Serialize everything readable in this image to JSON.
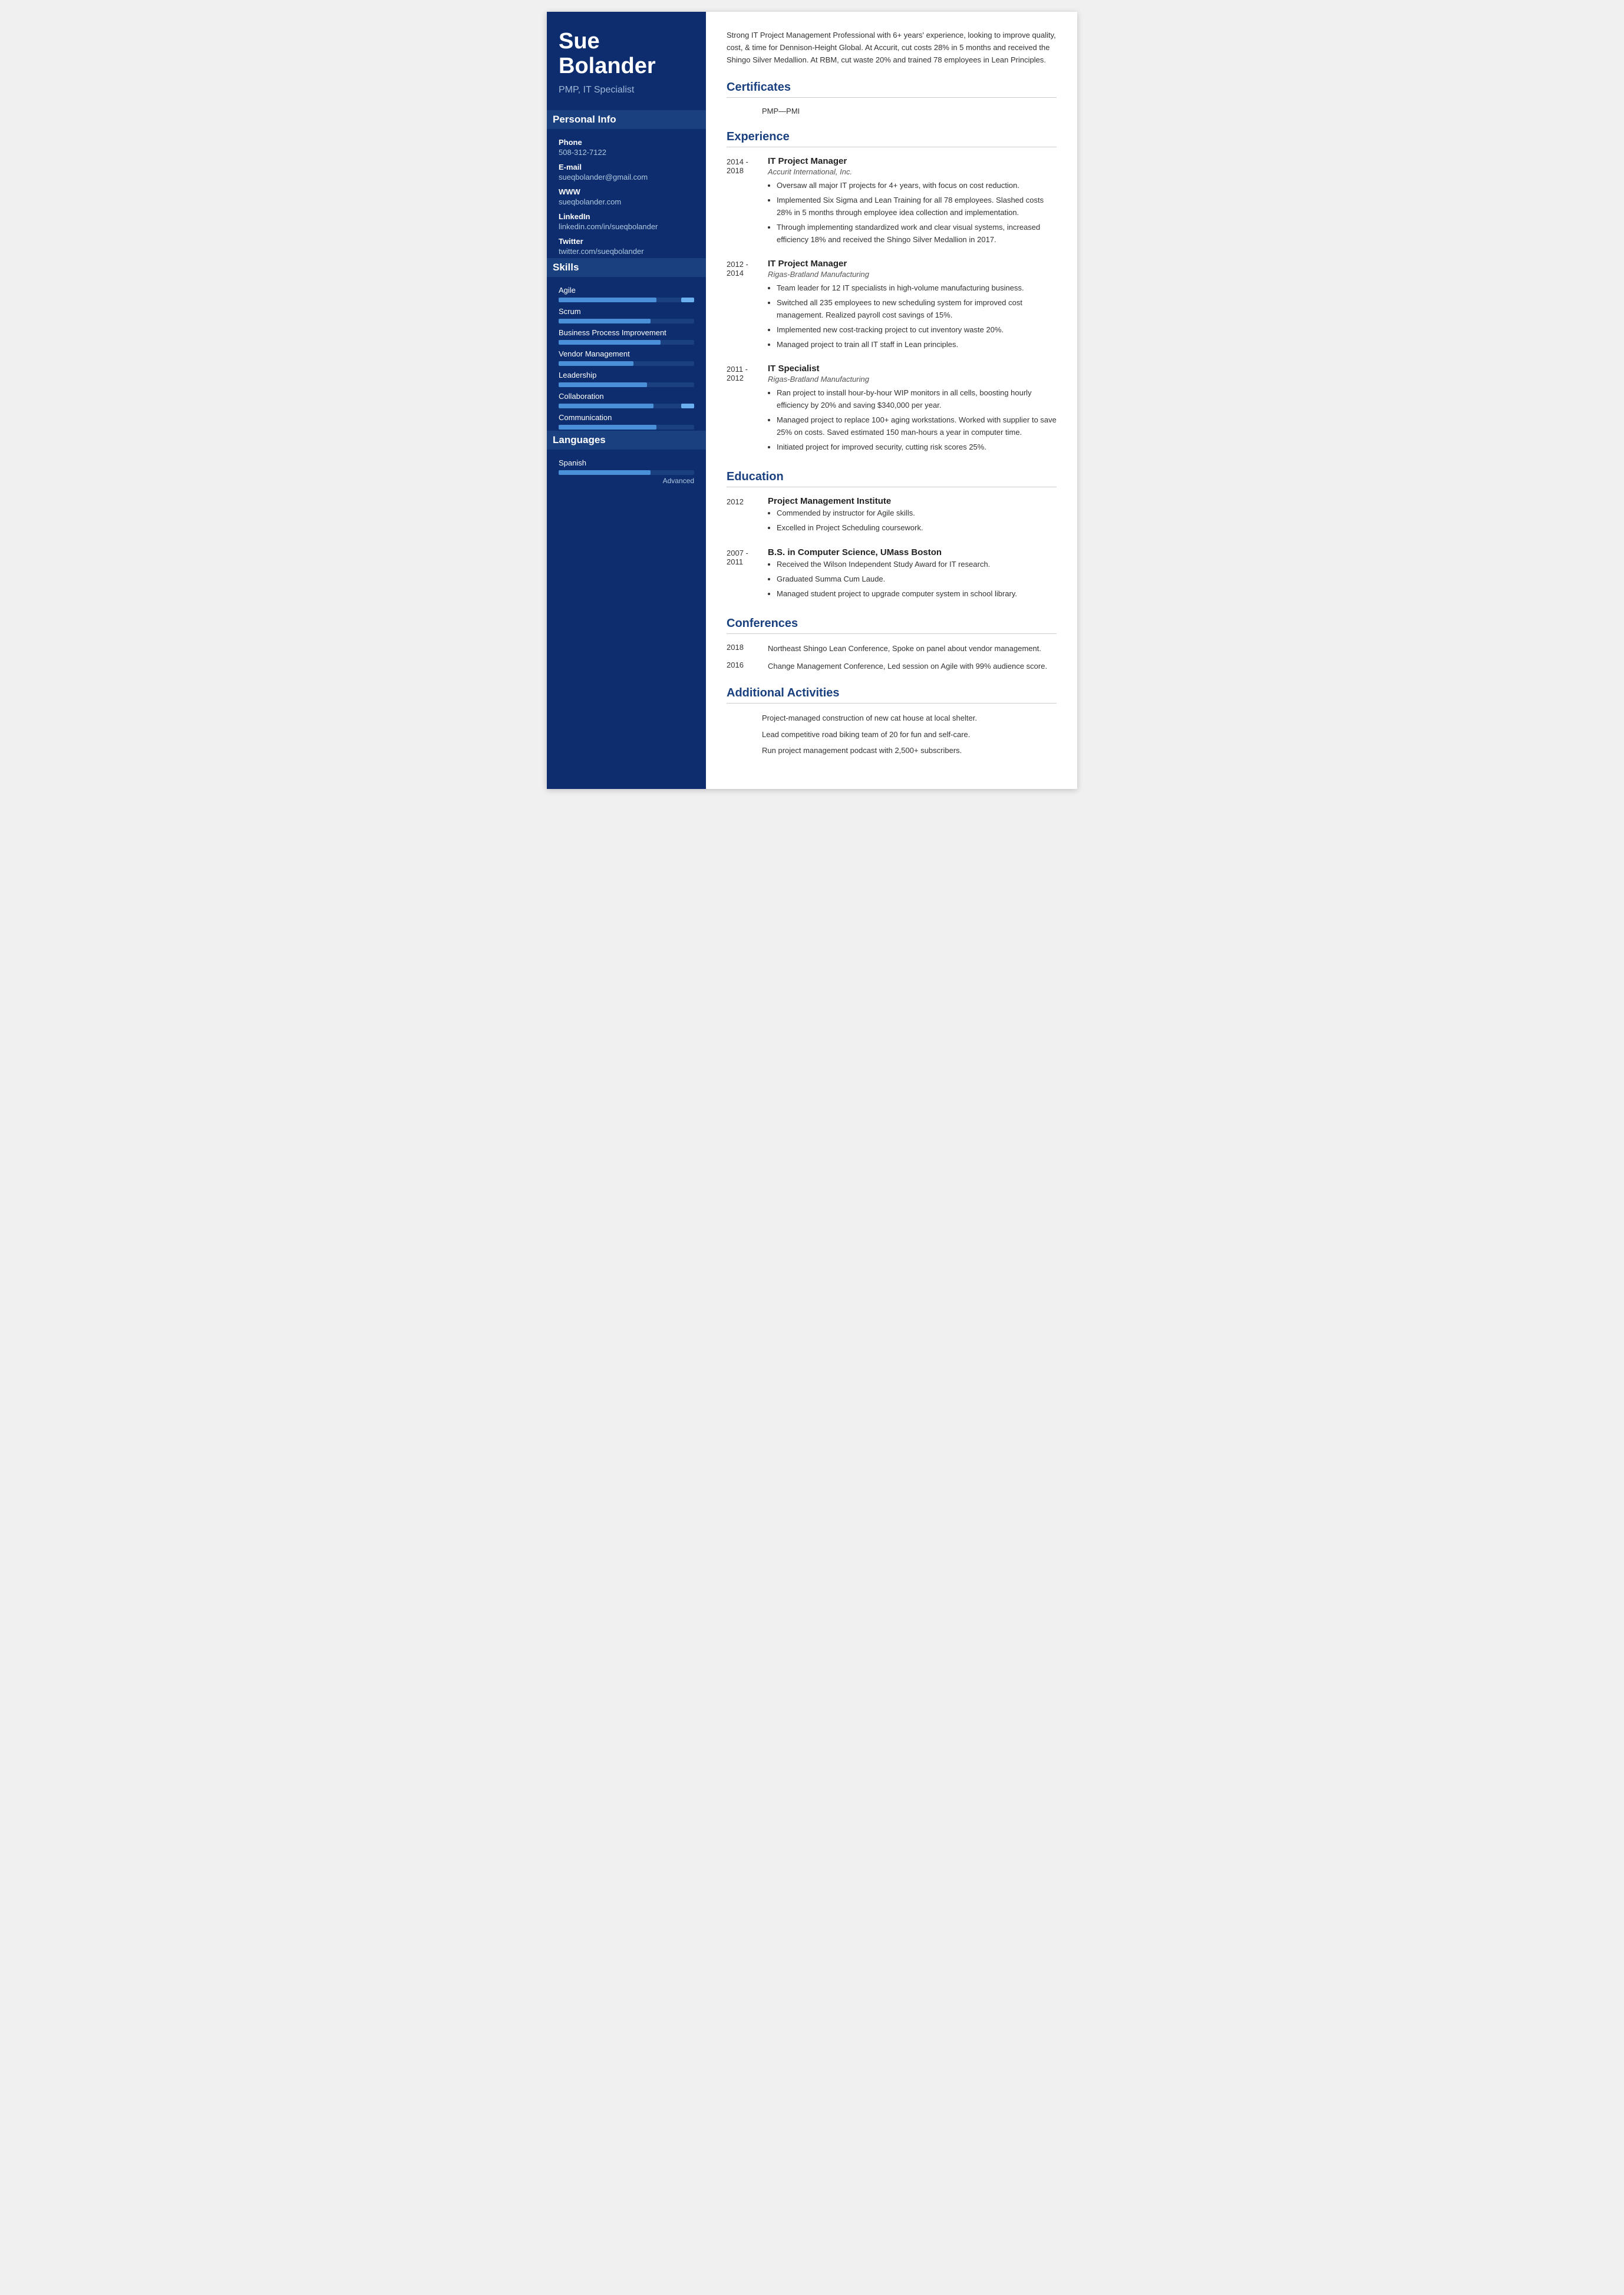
{
  "sidebar": {
    "name": "Sue\nBolander",
    "name_line1": "Sue",
    "name_line2": "Bolander",
    "title": "PMP, IT Specialist",
    "personal_info_label": "Personal Info",
    "phone_label": "Phone",
    "phone_value": "508-312-7122",
    "email_label": "E-mail",
    "email_value": "sueqbolander@gmail.com",
    "www_label": "WWW",
    "www_value": "sueqbolander.com",
    "linkedin_label": "LinkedIn",
    "linkedin_value": "linkedin.com/in/sueqbolander",
    "twitter_label": "Twitter",
    "twitter_value": "twitter.com/sueqbolander",
    "skills_label": "Skills",
    "skills": [
      {
        "name": "Agile",
        "fill_pct": 72,
        "has_accent": true
      },
      {
        "name": "Scrum",
        "fill_pct": 68,
        "has_accent": false
      },
      {
        "name": "Business Process Improvement",
        "fill_pct": 75,
        "has_accent": false
      },
      {
        "name": "Vendor Management",
        "fill_pct": 55,
        "has_accent": false
      },
      {
        "name": "Leadership",
        "fill_pct": 65,
        "has_accent": false
      },
      {
        "name": "Collaboration",
        "fill_pct": 70,
        "has_accent": true
      },
      {
        "name": "Communication",
        "fill_pct": 72,
        "has_accent": false
      }
    ],
    "languages_label": "Languages",
    "languages": [
      {
        "name": "Spanish",
        "fill_pct": 68,
        "level": "Advanced"
      }
    ]
  },
  "main": {
    "summary": "Strong IT Project Management Professional with 6+ years' experience, looking to improve quality, cost, & time for Dennison-Height Global. At Accurit, cut costs 28% in 5 months and received the Shingo Silver Medallion. At RBM, cut waste 20% and trained 78 employees in Lean Principles.",
    "certificates_title": "Certificates",
    "certificates": [
      {
        "text": "PMP—PMI"
      }
    ],
    "experience_title": "Experience",
    "experience": [
      {
        "date": "2014 -\n2018",
        "title": "IT Project Manager",
        "company": "Accurit International, Inc.",
        "bullets": [
          "Oversaw all major IT projects for 4+ years, with focus on cost reduction.",
          "Implemented Six Sigma and Lean Training for all 78 employees. Slashed costs 28% in 5 months through employee idea collection and implementation.",
          "Through implementing standardized work and clear visual systems, increased efficiency 18% and received the Shingo Silver Medallion in 2017."
        ]
      },
      {
        "date": "2012 -\n2014",
        "title": "IT Project Manager",
        "company": "Rigas-Bratland Manufacturing",
        "bullets": [
          "Team leader for 12 IT specialists in high-volume manufacturing business.",
          "Switched all 235 employees to new scheduling system for improved cost management. Realized payroll cost savings of 15%.",
          "Implemented new cost-tracking project to cut inventory waste 20%.",
          "Managed project to train all IT staff in Lean principles."
        ]
      },
      {
        "date": "2011 -\n2012",
        "title": "IT Specialist",
        "company": "Rigas-Bratland Manufacturing",
        "bullets": [
          "Ran project to install hour-by-hour WIP monitors in all cells, boosting hourly efficiency by 20% and saving $340,000 per year.",
          "Managed project to replace 100+ aging workstations. Worked with supplier to save 25% on costs. Saved estimated 150 man-hours a year in computer time.",
          "Initiated project for improved security, cutting risk scores 25%."
        ]
      }
    ],
    "education_title": "Education",
    "education": [
      {
        "date": "2012",
        "title": "Project Management Institute",
        "company": "",
        "bullets": [
          "Commended by instructor for Agile skills.",
          "Excelled in Project Scheduling coursework."
        ]
      },
      {
        "date": "2007 -\n2011",
        "title": "B.S. in Computer Science, UMass Boston",
        "company": "",
        "bullets": [
          "Received the Wilson Independent Study Award for IT research.",
          "Graduated Summa Cum Laude.",
          "Managed student project to upgrade computer system in school library."
        ]
      }
    ],
    "conferences_title": "Conferences",
    "conferences": [
      {
        "date": "2018",
        "text": "Northeast Shingo Lean Conference, Spoke on panel about vendor management."
      },
      {
        "date": "2016",
        "text": "Change Management Conference, Led session on Agile with 99% audience score."
      }
    ],
    "activities_title": "Additional Activities",
    "activities": [
      "Project-managed construction of new cat house at local shelter.",
      "Lead competitive road biking team of 20 for fun and self-care.",
      "Run project management podcast with 2,500+ subscribers."
    ]
  }
}
